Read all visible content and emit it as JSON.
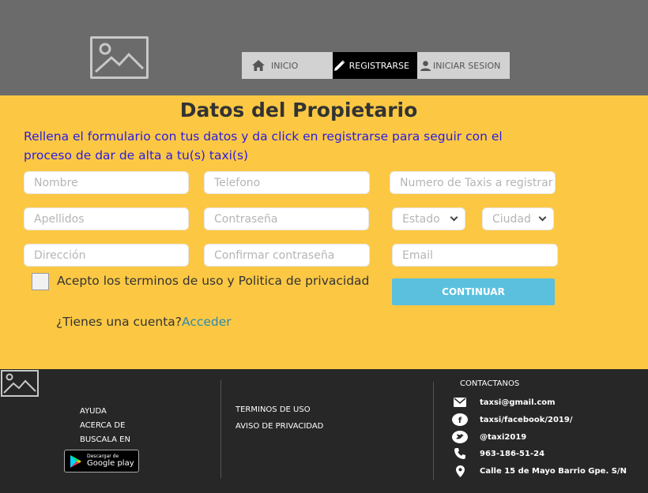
{
  "nav": {
    "items": [
      {
        "label": "INICIO",
        "icon": "home-icon"
      },
      {
        "label": "REGISTRARSE",
        "icon": "pencil-icon"
      },
      {
        "label": "INICIAR SESION",
        "icon": "person-icon"
      }
    ]
  },
  "form": {
    "title": "Datos del Propietario",
    "subtitle": "Rellena el formulario con tus datos y da click en registrarse para seguir con el proceso de dar de alta a tu(s) taxi(s)",
    "placeholders": {
      "nombre": "Nombre",
      "telefono": "Telefono",
      "num_taxis": "Numero de Taxis a registrar",
      "apellidos": "Apellidos",
      "contrasena": "Contraseña",
      "estado": "Estado",
      "ciudad": "Ciudad",
      "direccion": "Dirección",
      "confirmar": "Confirmar contraseña",
      "email": "Email"
    },
    "terms_label": "Acepto los terminos de uso y Politica de privacidad",
    "continue_label": "CONTINUAR",
    "account_question": "¿Tienes una cuenta?",
    "account_link": "Acceder"
  },
  "footer": {
    "col1": [
      "AYUDA",
      "ACERCA DE",
      "BUSCALA EN"
    ],
    "gplay_small": "Descargar de",
    "gplay_big": "Google play",
    "col2": [
      "TERMINOS DE USO",
      "AVISO DE PRIVACIDAD"
    ],
    "contact_title": "CONTACTANOS",
    "contacts": [
      {
        "icon": "mail-icon",
        "text": "taxsi@gmail.com"
      },
      {
        "icon": "facebook-icon",
        "text": "taxsi/facebook/2019/"
      },
      {
        "icon": "twitter-icon",
        "text": "@taxi2019"
      },
      {
        "icon": "phone-icon",
        "text": "963-186-51-24"
      },
      {
        "icon": "location-icon",
        "text": "Calle 15 de Mayo Barrio Gpe. S/N"
      }
    ]
  },
  "colors": {
    "header_bg": "#6b6b6b",
    "main_bg": "#fcc843",
    "subtitle_text": "#2a1ce0",
    "button_bg": "#5bc0de",
    "footer_bg": "#272727"
  }
}
